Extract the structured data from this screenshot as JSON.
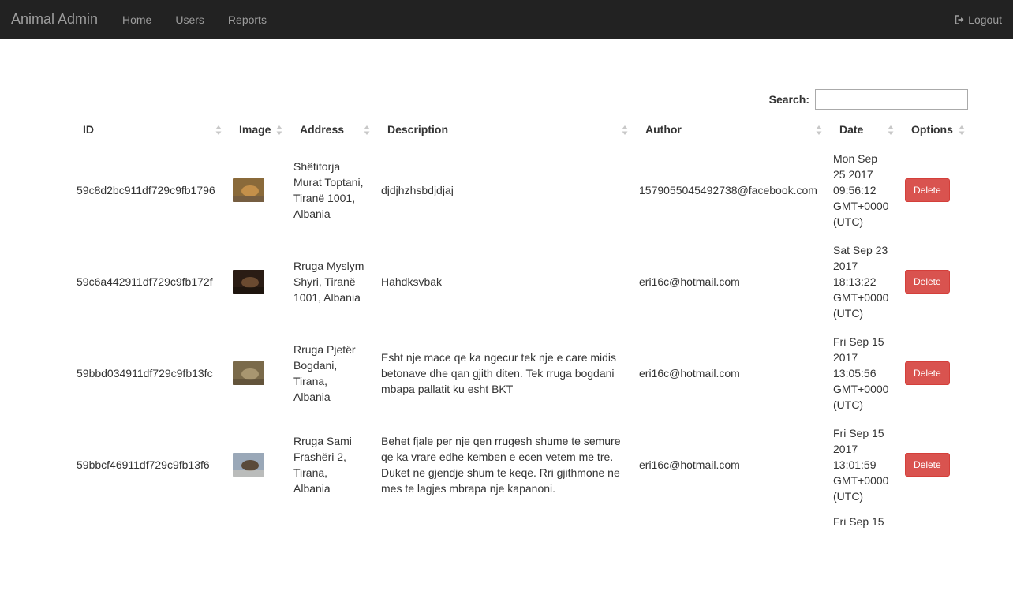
{
  "navbar": {
    "brand": "Animal Admin",
    "links": [
      "Home",
      "Users",
      "Reports"
    ],
    "logout": "Logout"
  },
  "search": {
    "label": "Search:",
    "value": ""
  },
  "table": {
    "columns": [
      "ID",
      "Image",
      "Address",
      "Description",
      "Author",
      "Date",
      "Options"
    ],
    "rows": [
      {
        "id": "59c8d2bc911df729c9fb1796",
        "address": "Shëtitorja Murat Toptani, Tiranë 1001, Albania",
        "description": "djdjhzhsbdjdjaj",
        "author": "1579055045492738@facebook.com",
        "date": "Mon Sep 25 2017 09:56:12 GMT+0000 (UTC)",
        "option": "Delete",
        "thumb_colors": [
          "#8a6a3a",
          "#c4904a",
          "#6e5a44"
        ]
      },
      {
        "id": "59c6a442911df729c9fb172f",
        "address": "Rruga Myslym Shyri, Tiranë 1001, Albania",
        "description": "Hahdksvbak",
        "author": "eri16c@hotmail.com",
        "date": "Sat Sep 23 2017 18:13:22 GMT+0000 (UTC)",
        "option": "Delete",
        "thumb_colors": [
          "#2a1c14",
          "#6a4a30",
          "#1a120c"
        ]
      },
      {
        "id": "59bbd034911df729c9fb13fc",
        "address": "Rruga Pjetër Bogdani, Tirana, Albania",
        "description": "Esht nje mace qe ka ngecur tek nje e care midis betonave dhe qan gjith diten. Tek rruga bogdani mbapa pallatit ku esht BKT",
        "author": "eri16c@hotmail.com",
        "date": "Fri Sep 15 2017 13:05:56 GMT+0000 (UTC)",
        "option": "Delete",
        "thumb_colors": [
          "#7a6a4a",
          "#a89670",
          "#5a4c34"
        ]
      },
      {
        "id": "59bbcf46911df729c9fb13f6",
        "address": "Rruga Sami Frashëri 2, Tirana, Albania",
        "description": "Behet fjale per nje qen rrugesh shume te semure qe ka vrare edhe kemben e ecen vetem me tre. Duket ne gjendje shum te keqe. Rri gjithmone ne mes te lagjes mbrapa nje kapanoni.",
        "author": "eri16c@hotmail.com",
        "date": "Fri Sep 15 2017 13:01:59 GMT+0000 (UTC)",
        "option": "Delete",
        "thumb_colors": [
          "#9aa8b8",
          "#5a4a3a",
          "#c8c4bc"
        ]
      }
    ],
    "partial_row_date": "Fri Sep 15"
  }
}
